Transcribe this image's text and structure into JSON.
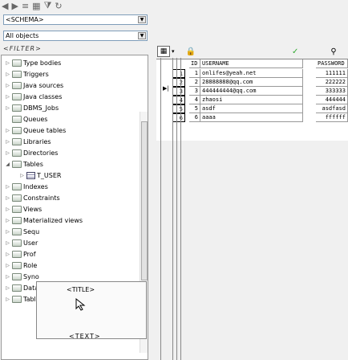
{
  "toolbar_top": {
    "icons": [
      "back-icon",
      "forward-icon",
      "sort-icon",
      "schema-icon",
      "filter-icon",
      "refresh-icon"
    ]
  },
  "schema_combo": {
    "value": "<SCHEMA>"
  },
  "object_combo": {
    "value": "All objects"
  },
  "filter_label": "<FILTER>",
  "tree": {
    "items": [
      {
        "label": "Type bodies",
        "expanded": false
      },
      {
        "label": "Triggers",
        "expanded": false
      },
      {
        "label": "Java sources",
        "expanded": false
      },
      {
        "label": "Java classes",
        "expanded": false
      },
      {
        "label": "DBMS_Jobs",
        "expanded": false
      },
      {
        "label": "Queues",
        "expanded": false
      },
      {
        "label": "Queue tables",
        "expanded": false
      },
      {
        "label": "Libraries",
        "expanded": false
      },
      {
        "label": "Directories",
        "expanded": false
      },
      {
        "label": "Tables",
        "expanded": true
      },
      {
        "label": "T_USER",
        "child": true
      },
      {
        "label": "Indexes",
        "expanded": false
      },
      {
        "label": "Constraints",
        "expanded": false
      },
      {
        "label": "Views",
        "expanded": false
      },
      {
        "label": "Materialized views",
        "expanded": false
      },
      {
        "label": "Sequ",
        "expanded": false
      },
      {
        "label": "User",
        "expanded": false
      },
      {
        "label": "Prof",
        "expanded": false
      },
      {
        "label": "Role",
        "expanded": false
      },
      {
        "label": "Syno",
        "expanded": false
      },
      {
        "label": "Data",
        "expanded": false
      },
      {
        "label": "Tablespaces",
        "expanded": false
      }
    ]
  },
  "popup": {
    "title": "<TITLE>",
    "text": "<TEXT>"
  },
  "grid": {
    "columns": [
      "ID",
      "USERNAME",
      "PASSWORD"
    ],
    "rows": [
      {
        "n": "1",
        "id": "1",
        "username": "onlifes@yeah.net",
        "password": "111111"
      },
      {
        "n": "2",
        "id": "2",
        "username": "28888888@qq.com",
        "password": "222222"
      },
      {
        "n": "3",
        "id": "3",
        "username": "444444444@qq.com",
        "password": "333333"
      },
      {
        "n": "4",
        "id": "4",
        "username": "zhaosi",
        "password": "444444"
      },
      {
        "n": "5",
        "id": "5",
        "username": "asdf",
        "password": "asdfasd"
      },
      {
        "n": "6",
        "id": "6",
        "username": "aaaa",
        "password": "ffffff"
      }
    ]
  }
}
